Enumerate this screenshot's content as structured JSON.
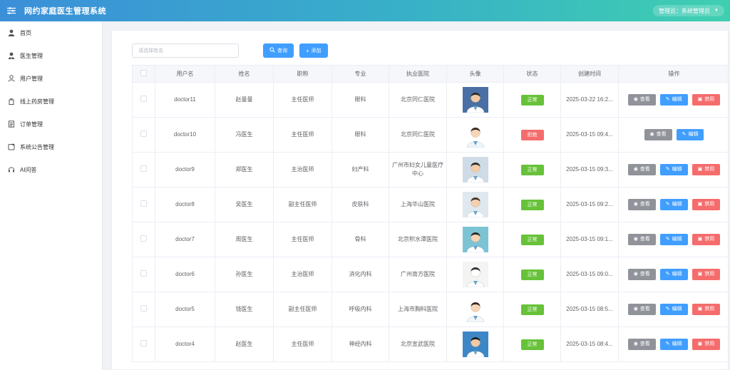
{
  "app": {
    "title": "网约家庭医生管理系统",
    "user_label": "管理员：系统管理员"
  },
  "sidebar": {
    "items": [
      {
        "label": "首页",
        "icon": "user-icon"
      },
      {
        "label": "医生管理",
        "icon": "doctor-icon"
      },
      {
        "label": "用户管理",
        "icon": "user-outline-icon"
      },
      {
        "label": "线上药房管理",
        "icon": "pharmacy-icon"
      },
      {
        "label": "订单管理",
        "icon": "document-icon"
      },
      {
        "label": "系统公告管理",
        "icon": "notice-icon"
      },
      {
        "label": "AI问答",
        "icon": "headset-icon"
      }
    ]
  },
  "search": {
    "placeholder": "请选择姓名",
    "query_label": "查询",
    "add_label": "添加"
  },
  "table": {
    "headers": [
      "",
      "用户名",
      "姓名",
      "职称",
      "专业",
      "执业医院",
      "头像",
      "状态",
      "创建时间",
      "操作"
    ],
    "actions": {
      "view": "查看",
      "edit": "编辑",
      "ban": "禁用"
    },
    "rows": [
      {
        "username": "doctor11",
        "name": "赵曼曼",
        "title": "主任医师",
        "major": "眼科",
        "hospital": "北京同仁医院",
        "status": "正常",
        "status_type": "ok",
        "created": "2025-03-22 16:2...",
        "avatar": "doctor-photo-male-desk"
      },
      {
        "username": "doctor10",
        "name": "冯医生",
        "title": "主任医师",
        "major": "眼科",
        "hospital": "北京同仁医院",
        "status": "拒绝",
        "status_type": "bad",
        "created": "2025-03-15 09:4...",
        "avatar": "doctor-illustration-female"
      },
      {
        "username": "doctor9",
        "name": "郑医生",
        "title": "主治医师",
        "major": "妇产科",
        "hospital": "广州市妇女儿童医疗中心",
        "status": "正常",
        "status_type": "ok",
        "created": "2025-03-15 09:3...",
        "avatar": "doctor-illustration-male"
      },
      {
        "username": "doctor8",
        "name": "吴医生",
        "title": "副主任医师",
        "major": "皮肤科",
        "hospital": "上海华山医院",
        "status": "正常",
        "status_type": "ok",
        "created": "2025-03-15 09:2...",
        "avatar": "doctor-illustration-female-ward"
      },
      {
        "username": "doctor7",
        "name": "周医生",
        "title": "主任医师",
        "major": "骨科",
        "hospital": "北京积水潭医院",
        "status": "正常",
        "status_type": "ok",
        "created": "2025-03-15 09:1...",
        "avatar": "doctor-illustration-female-teal"
      },
      {
        "username": "doctor6",
        "name": "孙医生",
        "title": "主治医师",
        "major": "消化内科",
        "hospital": "广州南方医院",
        "status": "正常",
        "status_type": "ok",
        "created": "2025-03-15 09:0...",
        "avatar": "doctor-sketch-male"
      },
      {
        "username": "doctor5",
        "name": "钱医生",
        "title": "副主任医师",
        "major": "呼吸内科",
        "hospital": "上海市胸科医院",
        "status": "正常",
        "status_type": "ok",
        "created": "2025-03-15 08:5...",
        "avatar": "doctor-illustration-female-white"
      },
      {
        "username": "doctor4",
        "name": "赵医生",
        "title": "主任医师",
        "major": "神经内科",
        "hospital": "北京宣武医院",
        "status": "正常",
        "status_type": "ok",
        "created": "2025-03-15 08:4...",
        "avatar": "doctor-illustration-male-mask"
      }
    ]
  }
}
